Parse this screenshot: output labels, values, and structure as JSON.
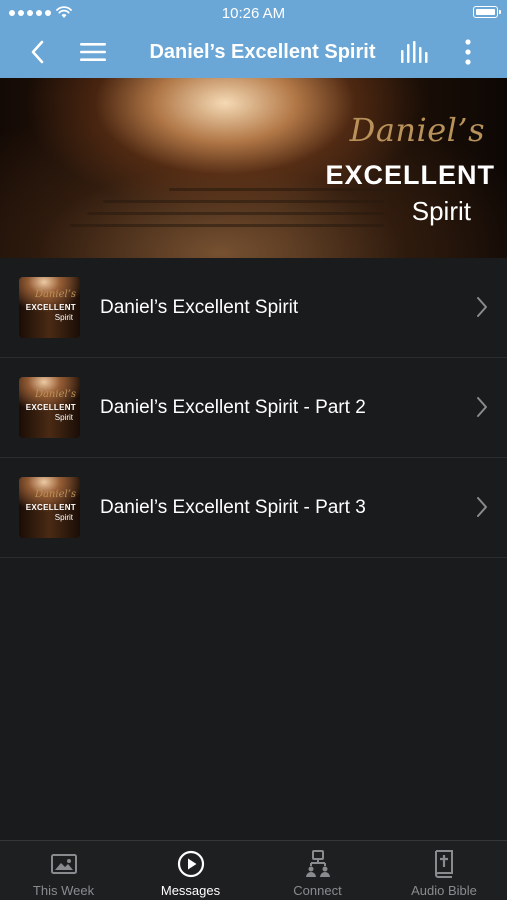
{
  "status_bar": {
    "time": "10:26 AM",
    "icons": [
      "signal-dots-icon",
      "wifi-icon",
      "battery-icon"
    ]
  },
  "nav_bar": {
    "title": "Daniel’s Excellent Spirit",
    "back_icon": "back-chevron-icon",
    "menu_icon": "hamburger-menu-icon",
    "audio_icon": "equalizer-icon",
    "more_icon": "more-vertical-icon"
  },
  "hero": {
    "script_title": "Daniel’s",
    "main_title": "EXCELLENT",
    "sub_title": "Spirit"
  },
  "messages": [
    {
      "title": "Daniel’s Excellent Spirit",
      "thumb_script": "Daniel’s",
      "thumb_main": "EXCELLENT",
      "thumb_sub": "Spirit"
    },
    {
      "title": "Daniel’s Excellent Spirit - Part 2",
      "thumb_script": "Daniel’s",
      "thumb_main": "EXCELLENT",
      "thumb_sub": "Spirit"
    },
    {
      "title": "Daniel’s Excellent Spirit - Part 3",
      "thumb_script": "Daniel’s",
      "thumb_main": "EXCELLENT",
      "thumb_sub": "Spirit"
    }
  ],
  "tabs": [
    {
      "label": "This Week",
      "icon": "image-icon",
      "active": false
    },
    {
      "label": "Messages",
      "icon": "play-circle-icon",
      "active": true
    },
    {
      "label": "Connect",
      "icon": "people-icon",
      "active": false
    },
    {
      "label": "Audio Bible",
      "icon": "bible-icon",
      "active": false
    }
  ],
  "colors": {
    "header": "#6aa6d6",
    "background": "#1a1b1d",
    "tab_bar": "#1e1f21",
    "tab_inactive": "#8a8b8e",
    "tab_active": "#ffffff",
    "script_gold": "#b8925a"
  }
}
